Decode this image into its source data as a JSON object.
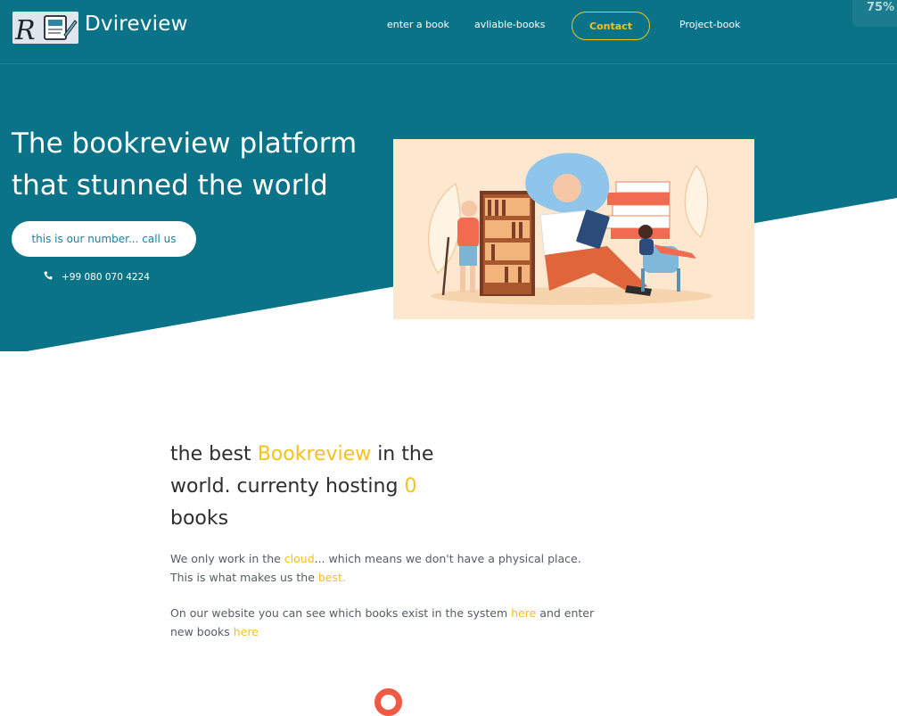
{
  "brand": {
    "name": "Dvireview",
    "logo_letter": "R"
  },
  "nav": {
    "items": [
      {
        "label": "enter a book"
      },
      {
        "label": "avliable-books"
      },
      {
        "label": "Contact"
      },
      {
        "label": "Project-book"
      }
    ],
    "progress_label": "75%"
  },
  "hero": {
    "title": "The bookreview platform that stunned the world",
    "cta_label": "this is our number... call us",
    "phone": "+99 080 070 4224",
    "icon": "phone-icon"
  },
  "content": {
    "headline": {
      "part1": "the best ",
      "highlight1": "Bookreview",
      "part2": " in the world. currenty hosting ",
      "highlight2": "0",
      "part3": " books"
    },
    "paragraph1": {
      "before": "We only work in the ",
      "link1": "cloud",
      "middle": "... which means we don't have a physical place. This is what makes us the ",
      "link2": "best."
    },
    "paragraph2": {
      "before": "On our website you can see which books exist in the system ",
      "link1": "here",
      "middle": " and enter new books ",
      "link2": "here"
    }
  },
  "colors": {
    "primary_teal": "#0b7388",
    "accent_yellow": "#f4c21a",
    "spinner_red": "#ef5a45"
  }
}
